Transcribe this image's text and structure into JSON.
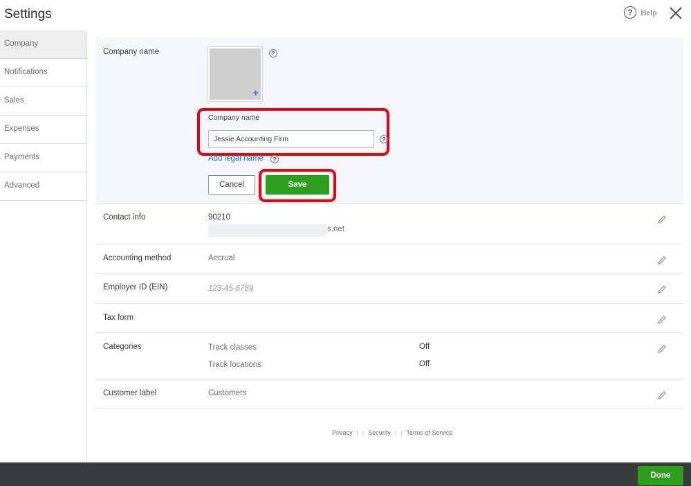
{
  "header": {
    "title": "Settings",
    "help_label": "Help",
    "help_glyph": "?"
  },
  "sidebar": {
    "items": [
      {
        "label": "Company",
        "active": true
      },
      {
        "label": "Notifications"
      },
      {
        "label": "Sales"
      },
      {
        "label": "Expenses"
      },
      {
        "label": "Payments"
      },
      {
        "label": "Advanced"
      }
    ]
  },
  "company": {
    "section_label": "Company name",
    "logo_plus": "+",
    "field_label": "Company name",
    "field_value": "Jessie Accounting Firm",
    "add_legal_name": "Add legal name",
    "cancel_label": "Cancel",
    "save_label": "Save",
    "help_glyph": "?"
  },
  "rows": {
    "contact": {
      "label": "Contact info",
      "zip": "90210",
      "email_partial": "s.net"
    },
    "accounting": {
      "label": "Accounting method",
      "value": "Accrual"
    },
    "ein": {
      "label": "Employer ID (EIN)",
      "placeholder": "123-45-6789"
    },
    "taxform": {
      "label": "Tax form"
    },
    "categories": {
      "label": "Categories",
      "items": [
        {
          "name": "Track classes",
          "value": "Off"
        },
        {
          "name": "Track locations",
          "value": "Off"
        }
      ]
    },
    "customer_label": {
      "label": "Customer label",
      "value": "Customers"
    }
  },
  "footer": {
    "privacy": "Privacy",
    "security": "Security",
    "terms": "Terms of Service",
    "sep": "|"
  },
  "bottom": {
    "done_label": "Done"
  },
  "colors": {
    "accent_green": "#2ca01c",
    "link_blue": "#0077c5",
    "highlight_red": "#e8000f",
    "bottom_bar": "#393a3d"
  }
}
